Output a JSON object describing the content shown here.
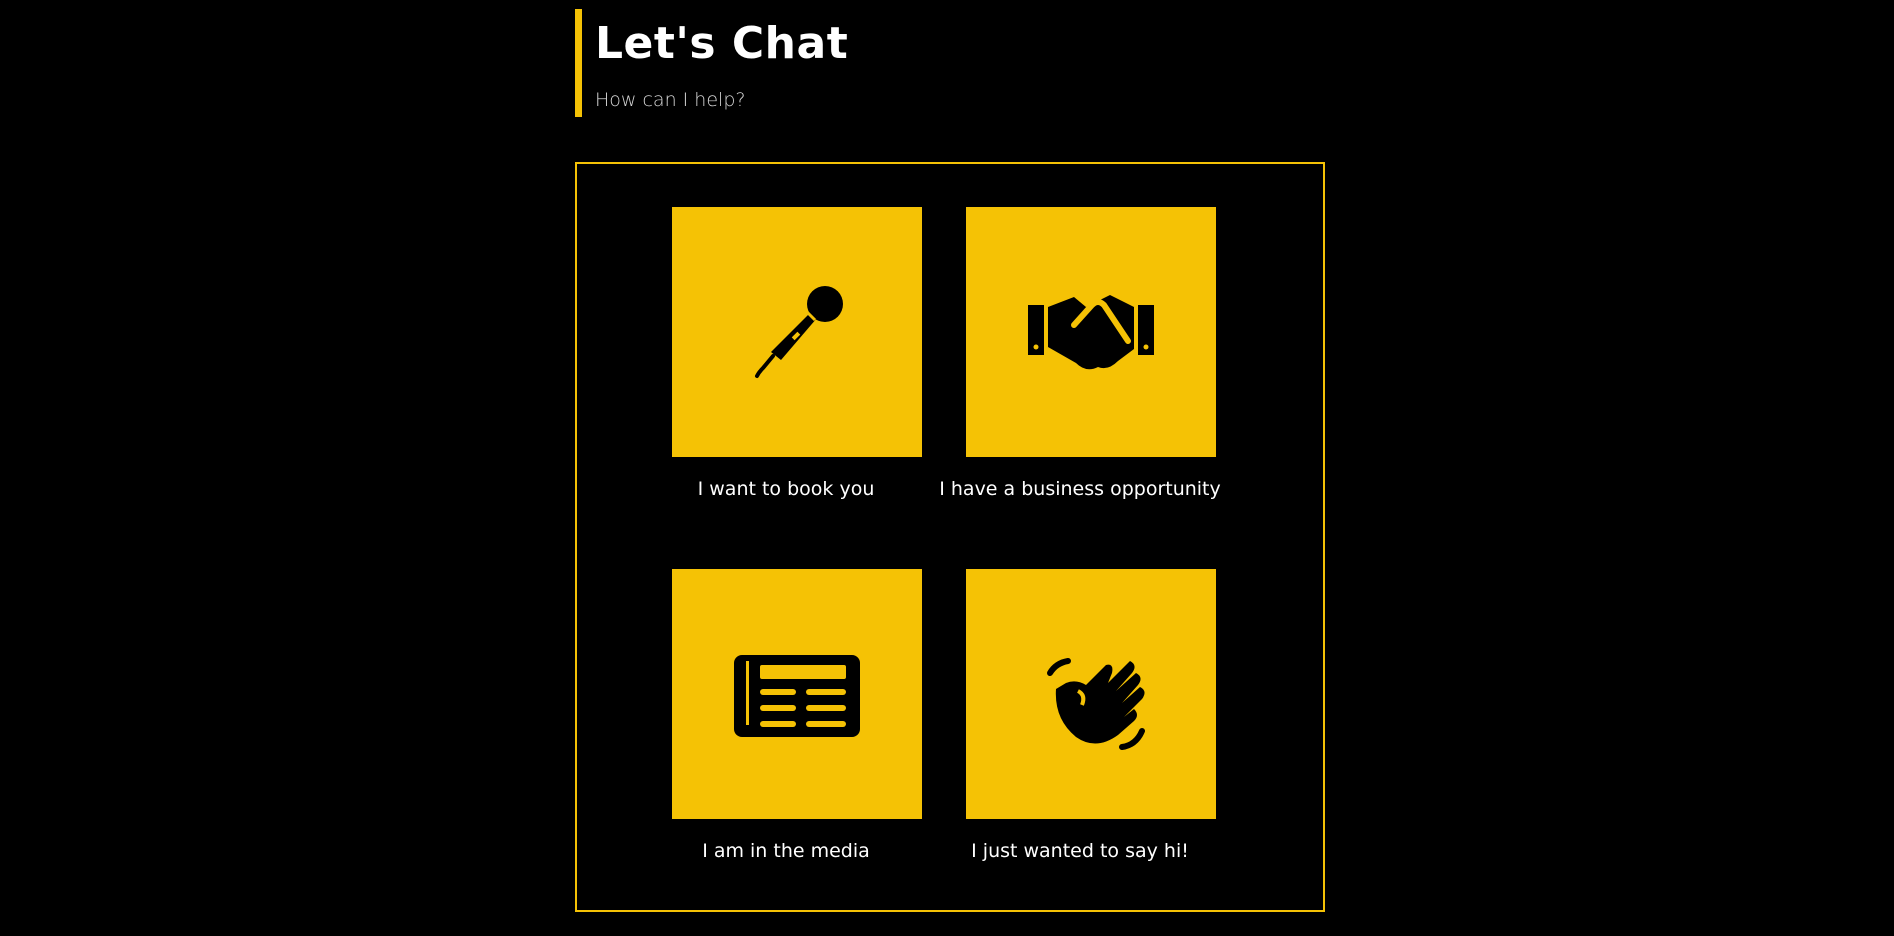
{
  "header": {
    "title": "Let's Chat",
    "subtitle": "How can I help?"
  },
  "options": [
    {
      "label": "I want to book you",
      "icon": "microphone-icon"
    },
    {
      "label": "I have a business opportunity",
      "icon": "handshake-icon"
    },
    {
      "label": "I am in the media",
      "icon": "newspaper-icon"
    },
    {
      "label": "I just wanted to say hi!",
      "icon": "waving-hand-icon"
    }
  ],
  "colors": {
    "accent": "#F5C205",
    "background": "#000000",
    "text": "#ffffff"
  }
}
